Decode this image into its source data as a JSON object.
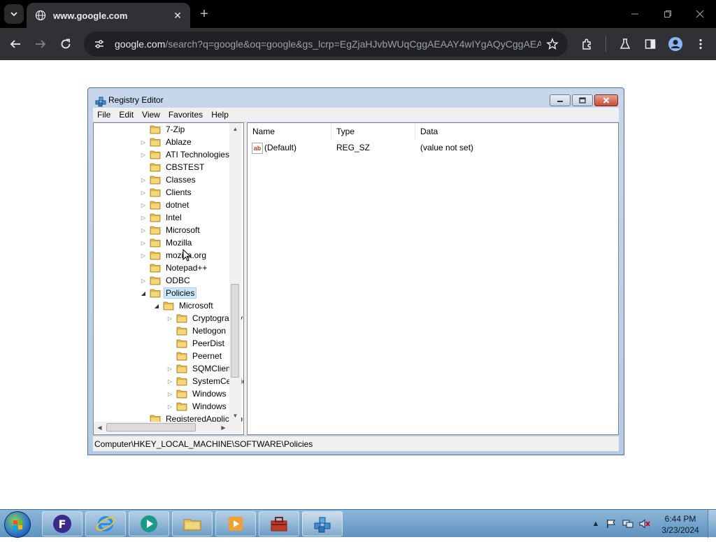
{
  "browser": {
    "tab": {
      "title": "www.google.com"
    },
    "url": {
      "host": "google.com",
      "path": "/search?q=google&oq=google&gs_lcrp=EgZjaHJvbWUqCggAEAAY4wIYgAQyCggAEA..."
    }
  },
  "regedit": {
    "title": "Registry Editor",
    "menu": [
      "File",
      "Edit",
      "View",
      "Favorites",
      "Help"
    ],
    "tree": [
      {
        "label": "7-Zip",
        "expander": "none"
      },
      {
        "label": "Ablaze",
        "expander": "collapsed"
      },
      {
        "label": "ATI Technologies",
        "expander": "collapsed"
      },
      {
        "label": "CBSTEST",
        "expander": "none"
      },
      {
        "label": "Classes",
        "expander": "collapsed"
      },
      {
        "label": "Clients",
        "expander": "collapsed"
      },
      {
        "label": "dotnet",
        "expander": "collapsed"
      },
      {
        "label": "Intel",
        "expander": "collapsed"
      },
      {
        "label": "Microsoft",
        "expander": "collapsed"
      },
      {
        "label": "Mozilla",
        "expander": "collapsed"
      },
      {
        "label": "mozilla.org",
        "expander": "collapsed"
      },
      {
        "label": "Notepad++",
        "expander": "none"
      },
      {
        "label": "ODBC",
        "expander": "collapsed"
      },
      {
        "label": "Policies",
        "expander": "expanded",
        "selected": true
      },
      {
        "label": "Microsoft",
        "expander": "expanded",
        "indent": 1
      },
      {
        "label": "Cryptography",
        "expander": "collapsed",
        "indent": 2
      },
      {
        "label": "Netlogon",
        "expander": "none",
        "indent": 2
      },
      {
        "label": "PeerDist",
        "expander": "none",
        "indent": 2
      },
      {
        "label": "Peernet",
        "expander": "none",
        "indent": 2
      },
      {
        "label": "SQMClient",
        "expander": "collapsed",
        "indent": 2
      },
      {
        "label": "SystemCertificates",
        "expander": "collapsed",
        "indent": 2
      },
      {
        "label": "Windows",
        "expander": "collapsed",
        "indent": 2
      },
      {
        "label": "Windows NT",
        "expander": "collapsed",
        "indent": 2
      },
      {
        "label": "RegisteredApplications",
        "expander": "none"
      }
    ],
    "columns": [
      "Name",
      "Type",
      "Data"
    ],
    "values": [
      {
        "name": "(Default)",
        "type": "REG_SZ",
        "data": "(value not set)"
      }
    ],
    "status_path": "Computer\\HKEY_LOCAL_MACHINE\\SOFTWARE\\Policies"
  },
  "taskbar": {
    "time": "6:44 PM",
    "date": "3/23/2024"
  }
}
